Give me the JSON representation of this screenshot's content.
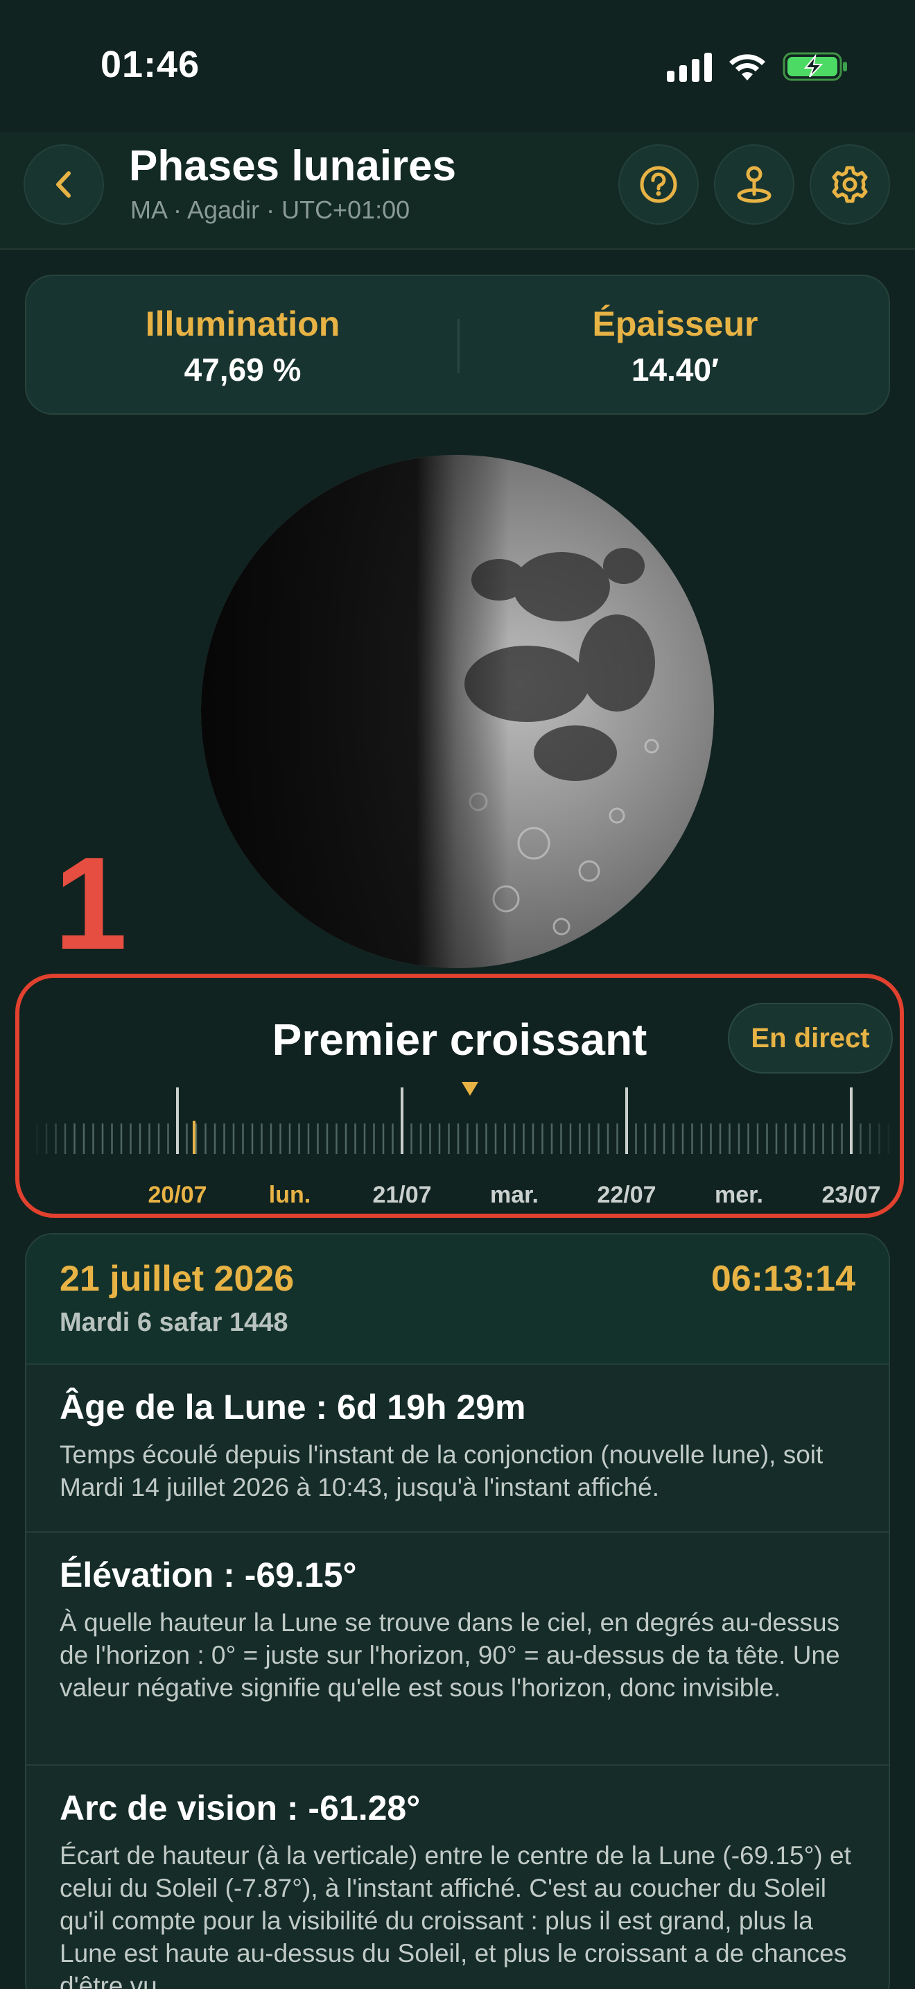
{
  "status_bar": {
    "time": "01:46"
  },
  "header": {
    "title": "Phases lunaires",
    "subtitle": "MA · Agadir · UTC+01:00"
  },
  "stats": {
    "illumination_label": "Illumination",
    "illumination_value": "47,69 %",
    "thickness_label": "Épaisseur",
    "thickness_value": "14.40′"
  },
  "annotation": {
    "number": "1"
  },
  "timeline": {
    "phase_name": "Premier croissant",
    "live_button": "En direct",
    "labels": [
      "20/07",
      "lun.",
      "21/07",
      "mar.",
      "22/07",
      "mer.",
      "23/07"
    ]
  },
  "detail": {
    "date": "21 juillet 2026",
    "time": "06:13:14",
    "hijri": "Mardi 6 safar 1448",
    "sections": [
      {
        "title": "Âge de la Lune : 6d 19h 29m",
        "text": "Temps écoulé depuis l'instant de la conjonction (nouvelle lune), soit Mardi 14 juillet 2026 à 10:43, jusqu'à l'instant affiché."
      },
      {
        "title": "Élévation : -69.15°",
        "text": "À quelle hauteur la Lune se trouve dans le ciel, en degrés au-dessus de l'horizon : 0° = juste sur l'horizon, 90° = au-dessus de ta tête. Une valeur négative signifie qu'elle est sous l'horizon, donc invisible."
      },
      {
        "title": "Arc de vision : -61.28°",
        "text": "Écart de hauteur (à la verticale) entre le centre de la Lune (-69.15°) et celui du Soleil (-7.87°), à l'instant affiché. C'est au coucher du Soleil qu'il compte pour la visibilité du croissant : plus il est grand, plus la Lune est haute au-dessus du Soleil, et plus le croissant a de chances d'être vu."
      }
    ]
  },
  "colors": {
    "accent": "#e8b345",
    "background": "#112320",
    "highlight_border": "#e2412f"
  }
}
